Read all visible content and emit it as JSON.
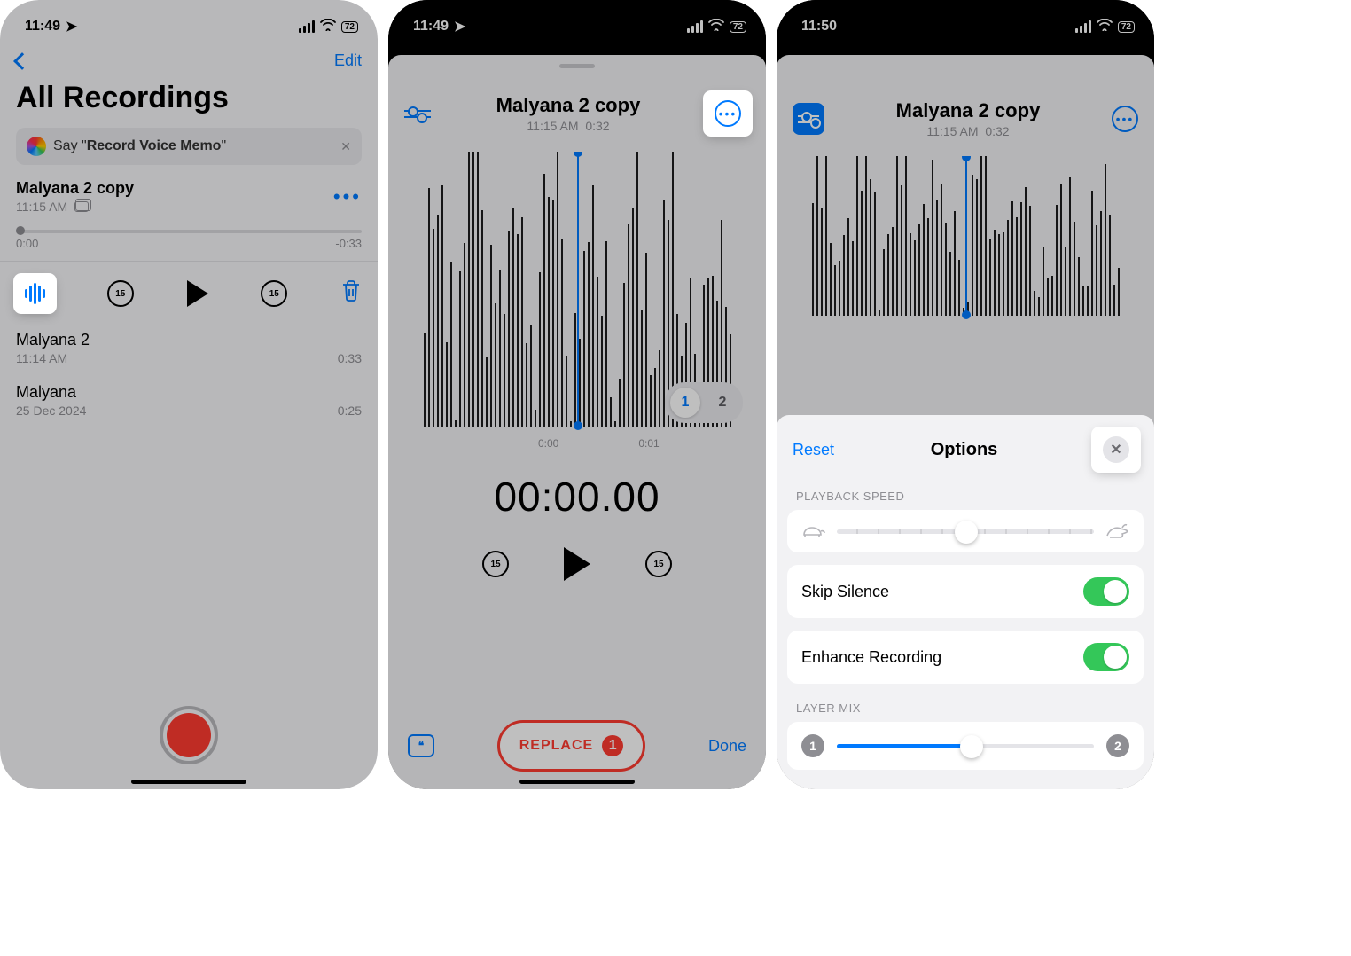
{
  "phone1": {
    "status": {
      "time": "11:49",
      "battery": "72"
    },
    "nav": {
      "edit": "Edit"
    },
    "title": "All Recordings",
    "siri": {
      "prefix": "Say \"",
      "phrase": "Record Voice Memo",
      "suffix": "\""
    },
    "selected": {
      "title": "Malyana 2 copy",
      "time": "11:15 AM",
      "pos": "0:00",
      "remain": "-0:33",
      "skip": "15"
    },
    "items": [
      {
        "title": "Malyana 2",
        "sub": "11:14 AM",
        "dur": "0:33"
      },
      {
        "title": "Malyana",
        "sub": "25 Dec 2024",
        "dur": "0:25"
      }
    ]
  },
  "phone2": {
    "status": {
      "time": "11:49",
      "battery": "72"
    },
    "edit": {
      "title": "Malyana 2 copy",
      "meta_time": "11:15 AM",
      "meta_dur": "0:32",
      "wf_t0": "0:00",
      "wf_t1": "0:01",
      "layers": {
        "a": "1",
        "b": "2"
      },
      "bigtime": "00:00.00",
      "skip": "15",
      "replace": "REPLACE",
      "replace_badge": "1",
      "done": "Done"
    }
  },
  "phone3": {
    "status": {
      "time": "11:50",
      "battery": "72"
    },
    "edit": {
      "title": "Malyana 2 copy",
      "meta_time": "11:15 AM",
      "meta_dur": "0:32"
    },
    "options": {
      "reset": "Reset",
      "title": "Options",
      "playback_label": "Playback Speed",
      "skip_silence": "Skip Silence",
      "enhance": "Enhance Recording",
      "layer_mix": "Layer Mix",
      "mix_left": "1",
      "mix_right": "2"
    }
  }
}
